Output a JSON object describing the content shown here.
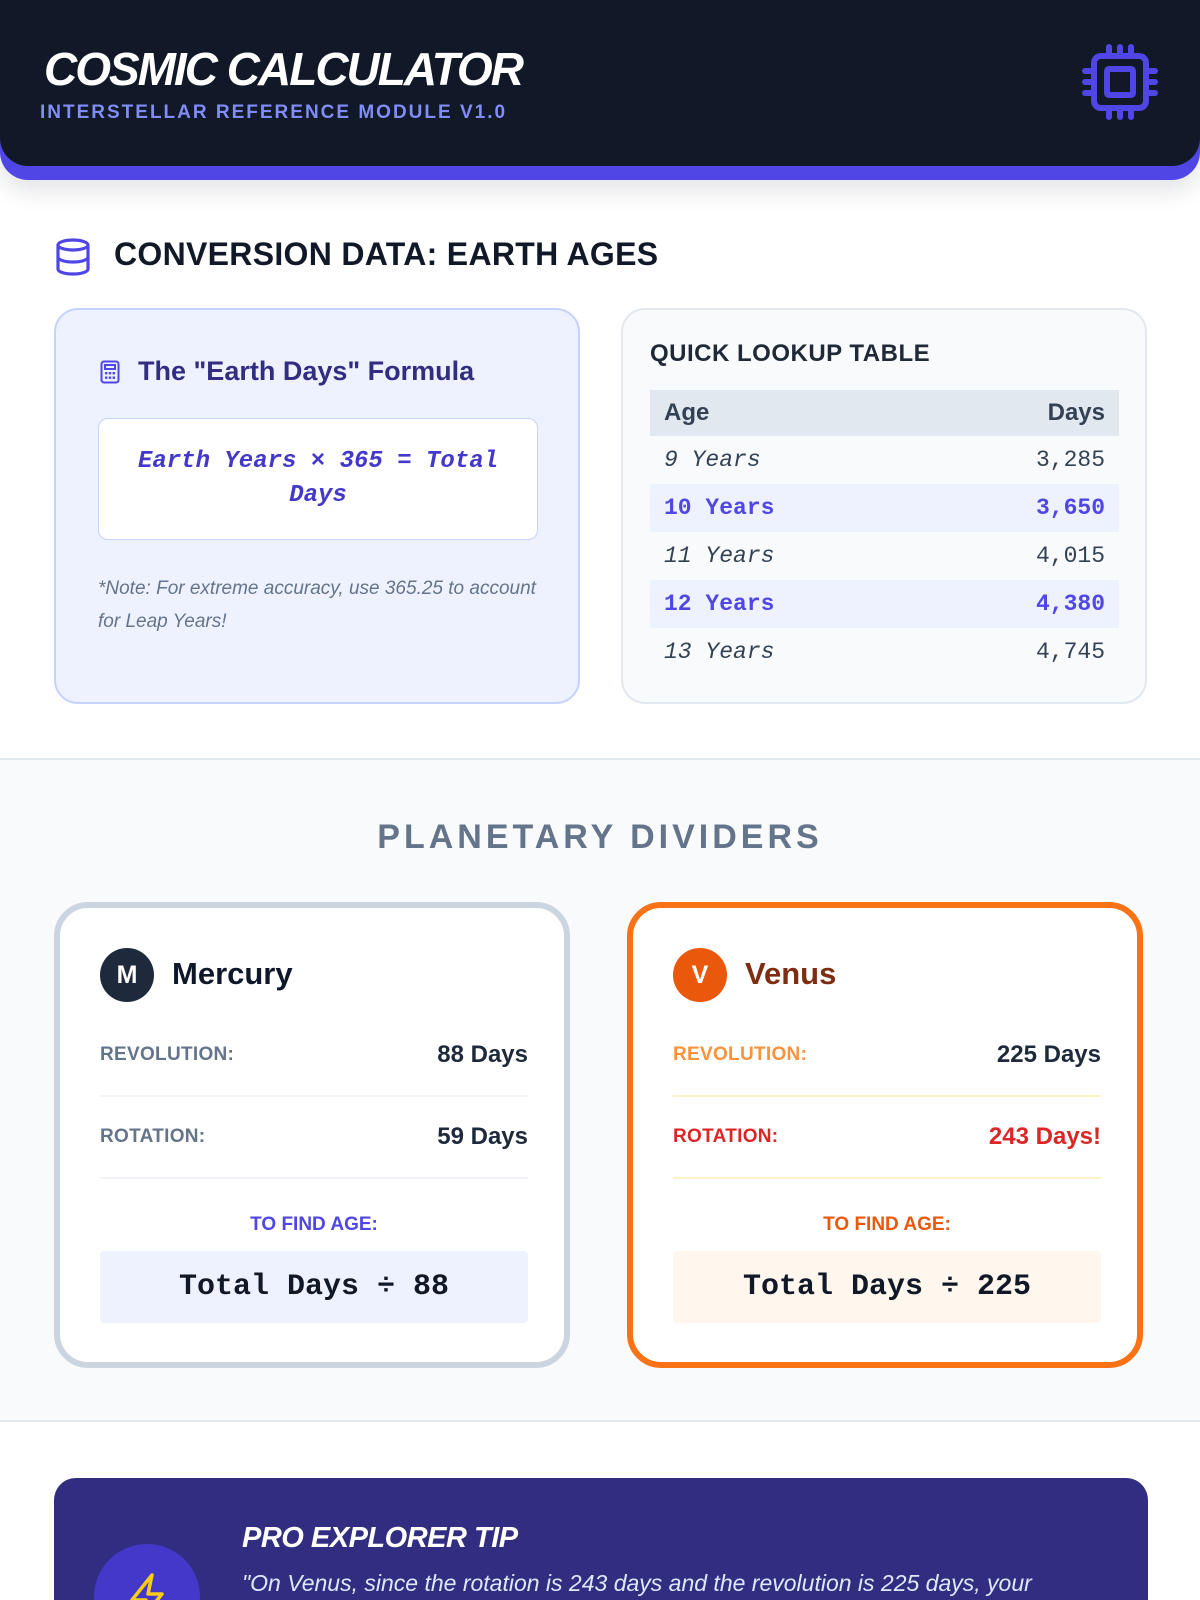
{
  "header": {
    "title": "COSMIC CALCULATOR",
    "subtitle": "INTERSTELLAR REFERENCE MODULE V1.0",
    "icon": "cpu-chip-icon"
  },
  "conversion": {
    "title": "CONVERSION DATA: EARTH AGES",
    "icon": "database-icon",
    "formula_card": {
      "title": "The \"Earth Days\" Formula",
      "icon": "calculator-icon",
      "formula": "Earth Years × 365 = Total Days",
      "note": "*Note: For extreme accuracy, use 365.25 to account for Leap Years!"
    },
    "lookup": {
      "title": "QUICK LOOKUP TABLE",
      "headers": [
        "Age",
        "Days"
      ],
      "rows": [
        {
          "age": "9 Years",
          "days": "3,285"
        },
        {
          "age": "10 Years",
          "days": "3,650"
        },
        {
          "age": "11 Years",
          "days": "4,015"
        },
        {
          "age": "12 Years",
          "days": "4,380"
        },
        {
          "age": "13 Years",
          "days": "4,745"
        }
      ]
    }
  },
  "planetary": {
    "title": "PLANETARY DIVIDERS",
    "planets": [
      {
        "initial": "M",
        "name": "Mercury",
        "revolution_label": "REVOLUTION:",
        "revolution_value": "88 Days",
        "rotation_label": "ROTATION:",
        "rotation_value": "59 Days",
        "find_label": "TO FIND AGE:",
        "formula": "Total Days ÷ 88"
      },
      {
        "initial": "V",
        "name": "Venus",
        "revolution_label": "REVOLUTION:",
        "revolution_value": "225 Days",
        "rotation_label": "ROTATION:",
        "rotation_value": "243 Days!",
        "find_label": "TO FIND AGE:",
        "formula": "Total Days ÷ 225"
      }
    ]
  },
  "tip": {
    "title": "PRO EXPLORER TIP",
    "text": "\"On Venus, since the rotation is 243 days and the revolution is 225 days, your",
    "icon": "lightning-bolt-icon"
  },
  "colors": {
    "header_bg": "#111827",
    "accent": "#5046e5",
    "venus_accent": "#f97316",
    "tip_bg": "#312e81"
  }
}
